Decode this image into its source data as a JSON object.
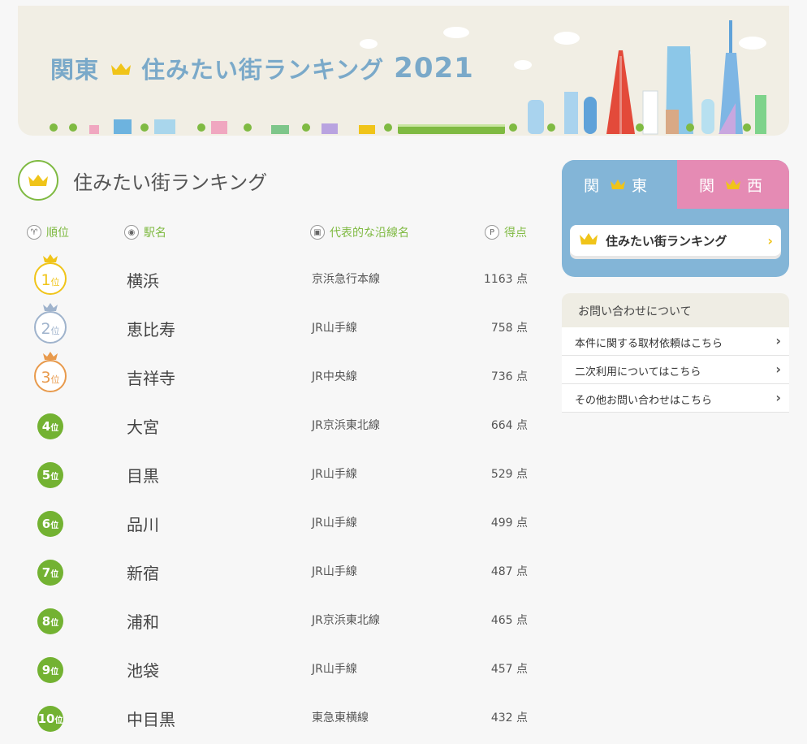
{
  "banner": {
    "region": "関東",
    "title": "住みたい街ランキング",
    "year": "2021"
  },
  "ranking": {
    "title": "住みたい街ランキング",
    "columns": {
      "rank": "順位",
      "station": "駅名",
      "line": "代表的な沿線名",
      "score": "得点"
    },
    "rank_unit": "位",
    "score_unit": "点",
    "rows": [
      {
        "rank": "1",
        "station": "横浜",
        "line": "京浜急行本線",
        "score": "1163"
      },
      {
        "rank": "2",
        "station": "恵比寿",
        "line": "JR山手線",
        "score": "758"
      },
      {
        "rank": "3",
        "station": "吉祥寺",
        "line": "JR中央線",
        "score": "736"
      },
      {
        "rank": "4",
        "station": "大宮",
        "line": "JR京浜東北線",
        "score": "664"
      },
      {
        "rank": "5",
        "station": "目黒",
        "line": "JR山手線",
        "score": "529"
      },
      {
        "rank": "6",
        "station": "品川",
        "line": "JR山手線",
        "score": "499"
      },
      {
        "rank": "7",
        "station": "新宿",
        "line": "JR山手線",
        "score": "487"
      },
      {
        "rank": "8",
        "station": "浦和",
        "line": "JR京浜東北線",
        "score": "465"
      },
      {
        "rank": "9",
        "station": "池袋",
        "line": "JR山手線",
        "score": "457"
      },
      {
        "rank": "10",
        "station": "中目黒",
        "line": "東急東横線",
        "score": "432"
      }
    ]
  },
  "region_tabs": {
    "kanto": [
      "関",
      "東"
    ],
    "kansai": [
      "関",
      "西"
    ],
    "link_label": "住みたい街ランキング"
  },
  "inquiry": {
    "title": "お問い合わせについて",
    "items": [
      "本件に関する取材依頼はこちら",
      "二次利用についてはこちら",
      "その他お問い合わせはこちら"
    ]
  },
  "colors": {
    "gold": "#f0c419",
    "silver": "#9fb3cc",
    "bronze": "#e89a4c",
    "green": "#73b232",
    "kanto": "#83b5d7",
    "kansai": "#e58bb4"
  }
}
